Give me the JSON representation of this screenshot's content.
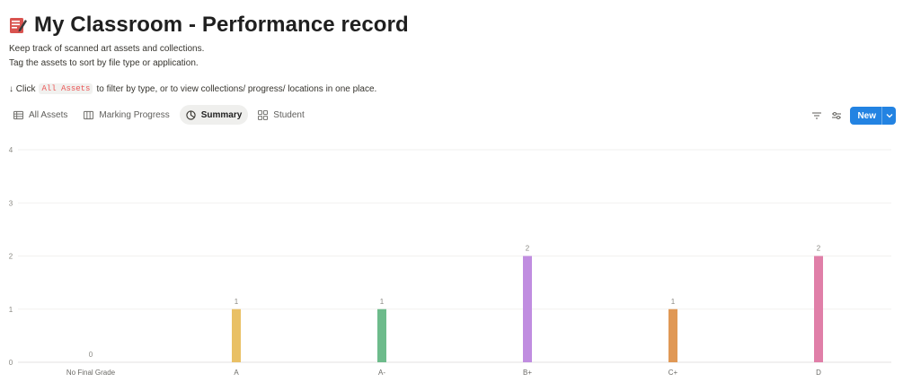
{
  "page": {
    "icon": "memo-pencil-icon",
    "title": "My Classroom - Performance record",
    "description_line1": "Keep track of scanned art assets and collections.",
    "description_line2": "Tag the assets to sort by file type or application.",
    "hint_prefix": "↓ Click",
    "hint_code": "All Assets",
    "hint_suffix": "to filter by type, or to view collections/ progress/ locations in one place."
  },
  "tabs": [
    {
      "label": "All Assets",
      "icon": "table-icon",
      "active": false
    },
    {
      "label": "Marking Progress",
      "icon": "board-icon",
      "active": false
    },
    {
      "label": "Summary",
      "icon": "chart-icon",
      "active": true
    },
    {
      "label": "Student",
      "icon": "gallery-icon",
      "active": false
    }
  ],
  "toolbar": {
    "filter_icon": "filter-icon",
    "settings_icon": "sliders-icon",
    "new_label": "New",
    "new_menu_icon": "chevron-down-icon"
  },
  "chart_data": {
    "type": "bar",
    "categories": [
      "No Final Grade",
      "A",
      "A-",
      "B+",
      "C+",
      "D"
    ],
    "values": [
      0,
      1,
      1,
      2,
      1,
      2
    ],
    "colors": [
      "#cccccc",
      "#e9c065",
      "#6dbb8b",
      "#c08de0",
      "#e09855",
      "#e07fa8"
    ],
    "ylim": [
      0,
      4
    ],
    "yticks": [
      0,
      1,
      2,
      3,
      4
    ],
    "grid": true,
    "data_labels": true,
    "legend": "none"
  }
}
